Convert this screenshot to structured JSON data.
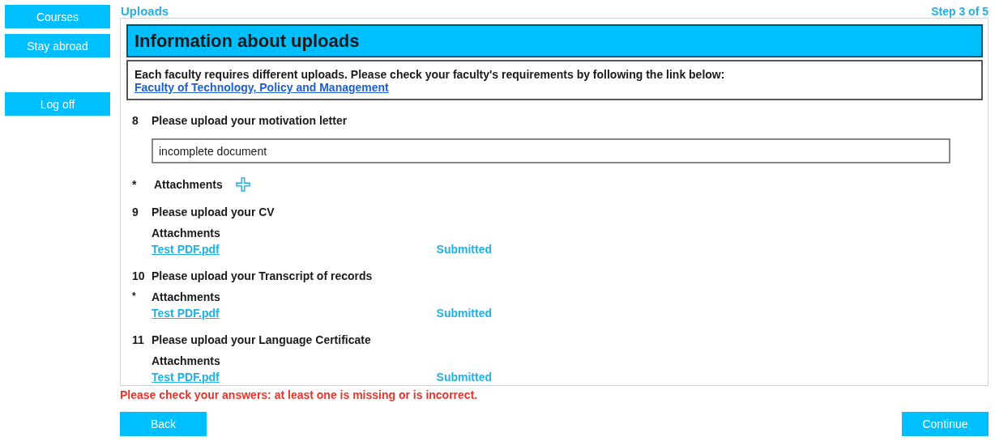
{
  "sidebar": {
    "items": [
      {
        "label": "Courses"
      },
      {
        "label": "Stay abroad"
      },
      {
        "label": "Log off",
        "kind": "separated"
      }
    ]
  },
  "page": {
    "title": "Uploads",
    "step": "Step 3 of 5"
  },
  "section": {
    "heading": "Information about uploads",
    "info": "Each faculty requires different uploads. Please check your faculty's requirements by following the link below:",
    "info_link": "Faculty of Technology, Policy and Management"
  },
  "questions": [
    {
      "number": "8",
      "label": "Please upload your motivation letter",
      "kind": "text",
      "value": "incomplete document",
      "required": true,
      "attachments_label": "Attachments"
    },
    {
      "number": "9",
      "label": "Please upload your CV",
      "kind": "files",
      "required": false,
      "attachments_label": "Attachments",
      "files": [
        {
          "name": "Test PDF.pdf",
          "status": "Submitted"
        }
      ]
    },
    {
      "number": "10",
      "label": "Please upload your Transcript of records",
      "kind": "files",
      "required": true,
      "attachments_label": "Attachments",
      "files": [
        {
          "name": "Test PDF.pdf",
          "status": "Submitted"
        }
      ]
    },
    {
      "number": "11",
      "label": "Please upload your Language Certificate",
      "kind": "files",
      "required": false,
      "attachments_label": "Attachments",
      "files": [
        {
          "name": "Test PDF.pdf",
          "status": "Submitted"
        }
      ]
    }
  ],
  "required_mark": "*",
  "error": "Please check your answers: at least one is missing or is incorrect.",
  "buttons": {
    "back": "Back",
    "continue": "Continue"
  }
}
